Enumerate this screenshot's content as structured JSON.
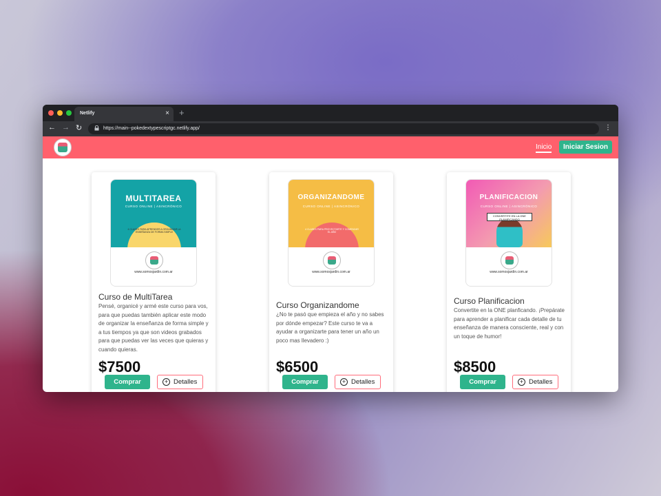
{
  "browser": {
    "tab_title": "Netlify",
    "tab_close": "×",
    "new_tab": "+",
    "url": "https://main--pokedextypescriptgc.netlify.app/",
    "back": "←",
    "forward": "→",
    "reload": "↻",
    "menu": "⋮"
  },
  "navbar": {
    "inicio": "Inicio",
    "login": "Iniciar Sesion"
  },
  "colors": {
    "navbar": "#ff606c",
    "buy_button": "#2fb48c",
    "details_border": "#ff6b7a"
  },
  "courses": [
    {
      "cover_title": "MULTITAREA",
      "cover_subtitle": "CURSO ONLINE  |  ASINCRÓNICO",
      "cover_text": "4 CLASES PARA APRENDER A ORGANIZAR LA ENSEÑANZA DE FORMA SIMPLE",
      "cover_site": "www.somosjardin.com.ar",
      "title": "Curso de MultiTarea",
      "description": "Pensé, organicé y armé este curso para vos, para que puedas también aplicar este modo de organizar la enseñanza de forma simple y a tus tiempos ya que son videos grabados para que puedas ver las veces que quieras y cuando quieras.",
      "price": "$7500",
      "buy_label": "Comprar",
      "details_label": "Detalles",
      "details_icon": "plus-circle-icon"
    },
    {
      "cover_title": "ORGANIZANDOME",
      "cover_subtitle": "CURSO ONLINE  |  ASINCRÓNICO",
      "cover_text": "4 CLASES PARA PROYECTARTE Y COMENZAR EL AÑO",
      "cover_site": "www.somosjardin.com.ar",
      "title": "Curso Organizandome",
      "description": "¿No te pasó que empieza el año y no sabes por dónde empezar? Este curso te va a ayudar a organizarte para tener un año un poco mas llevadero :)",
      "price": "$6500",
      "buy_label": "Comprar",
      "details_label": "Detalles",
      "details_icon": "plus-circle-icon"
    },
    {
      "cover_title": "PLANIFICACION",
      "cover_subtitle": "CURSO ONLINE  |  ASINCRÓNICO",
      "cover_text": "CONVERTITE EN LA ONE PLANIFICANDO",
      "cover_site": "www.somosjardin.com.ar",
      "title": "Curso Planificacion",
      "description": "Convertite en la ONE planficando. ¡Prepárate para aprender a planificar cada detalle de tu enseñanza de manera consciente, real y con un toque de humor!",
      "price": "$8500",
      "buy_label": "Comprar",
      "details_label": "Detalles",
      "details_icon": "plus-circle-icon"
    }
  ]
}
